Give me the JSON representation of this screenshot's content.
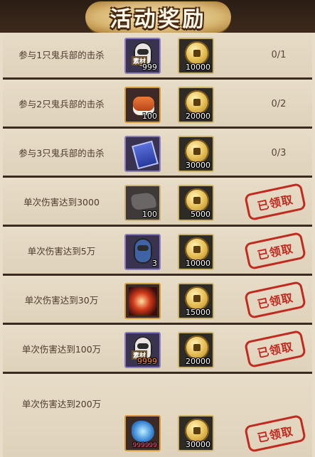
{
  "header": {
    "title": "活动奖励"
  },
  "rows": [
    {
      "desc": "参与1只鬼兵部的击杀",
      "item_qty": "999",
      "item_tag": "素材",
      "item_icon": "daruma-material-icon",
      "coin_qty": "10000",
      "progress": "0/1",
      "claimed_label": ""
    },
    {
      "desc": "参与2只鬼兵部的击杀",
      "item_qty": "100",
      "item_tag": "",
      "item_icon": "sushi-icon",
      "coin_qty": "20000",
      "progress": "0/2",
      "claimed_label": ""
    },
    {
      "desc": "参与3只鬼兵部的击杀",
      "item_qty": "",
      "item_tag": "",
      "item_icon": "scroll-icon",
      "coin_qty": "30000",
      "progress": "0/3",
      "claimed_label": ""
    },
    {
      "desc": "单次伤害达到3000",
      "item_qty": "100",
      "item_tag": "",
      "item_icon": "rock-icon",
      "coin_qty": "5000",
      "progress": "",
      "claimed_label": "已领取"
    },
    {
      "desc": "单次伤害达到5万",
      "item_qty": "3",
      "item_tag": "",
      "item_icon": "blue-daruma-icon",
      "coin_qty": "10000",
      "progress": "",
      "claimed_label": "已领取"
    },
    {
      "desc": "单次伤害达到30万",
      "item_qty": "",
      "item_tag": "",
      "item_icon": "fire-card-icon",
      "coin_qty": "15000",
      "progress": "",
      "claimed_label": "已领取"
    },
    {
      "desc": "单次伤害达到100万",
      "item_qty": "9999",
      "item_tag": "素材",
      "item_icon": "daruma-material-icon",
      "coin_qty": "20000",
      "progress": "",
      "claimed_label": "已领取"
    },
    {
      "desc": "单次伤害达到200万",
      "item_qty": "999999",
      "item_tag": "",
      "item_icon": "crystal-icon",
      "coin_qty": "30000",
      "progress": "",
      "claimed_label": "已领取"
    }
  ]
}
